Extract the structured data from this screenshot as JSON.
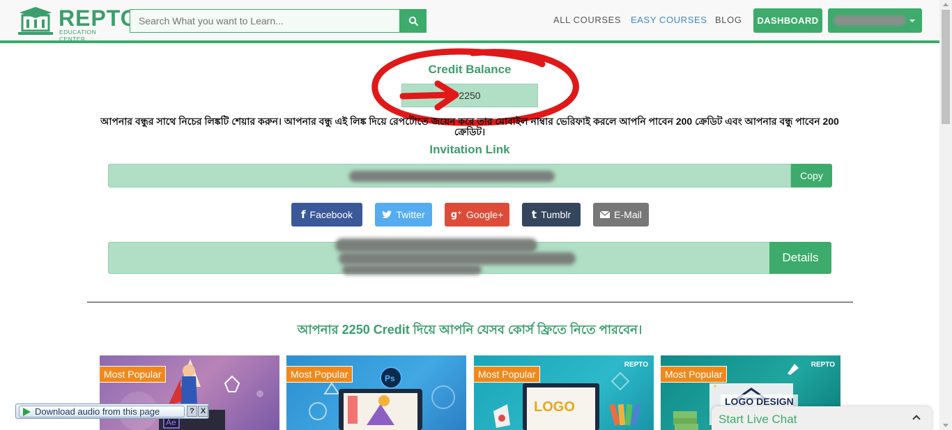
{
  "header": {
    "logo_text": "REPTO",
    "logo_subtext": "EDUCATION CENTER",
    "search_placeholder": "Search What you want to Learn...",
    "nav": {
      "all_courses": "ALL COURSES",
      "easy_courses": "EASY COURSES",
      "blog": "BLOG"
    },
    "dashboard_label": "DASHBOARD"
  },
  "credit": {
    "title": "Credit Balance",
    "value": "2250"
  },
  "share": {
    "message": "আপনার বন্ধুর সাথে নিচের লিঙ্কটি শেয়ার করুন। আপনার বন্ধু এই লিঙ্ক দিয়ে রেপটোতে জয়েন করে তার মোবাইল নাম্বার ভেরিফাই করলে আপনি পাবেন 200 ক্রেডিট এবং আপনার বন্ধু পাবেন 200 ক্রেডিট।",
    "invitation_title": "Invitation Link",
    "copy_label": "Copy",
    "buttons": {
      "facebook": "Facebook",
      "twitter": "Twitter",
      "google": "Google+",
      "tumblr": "Tumblr",
      "email": "E-Mail"
    },
    "details_label": "Details"
  },
  "courses": {
    "heading": "আপনার 2250 Credit দিয়ে আপনি যেসব কোর্স ফ্রিতে নিতে পারবেন।",
    "cards": [
      {
        "badge": "Most Popular",
        "brand": "",
        "logo": ""
      },
      {
        "badge": "Most Popular",
        "brand": "",
        "logo": ""
      },
      {
        "badge": "Most Popular",
        "brand": "REPTO",
        "logo": "LOGO"
      },
      {
        "badge": "Most Popular",
        "brand": "REPTO",
        "logo": "LOGO DESIGN"
      }
    ]
  },
  "overlays": {
    "download_audio": "Download audio from this page",
    "help": "?",
    "close": "X",
    "live_chat": "Start Live Chat"
  },
  "colors": {
    "brand_green": "#3dab6b",
    "field_green": "#b0dfc5",
    "link_blue": "#3f88c5",
    "annotation_red": "#e01818"
  }
}
